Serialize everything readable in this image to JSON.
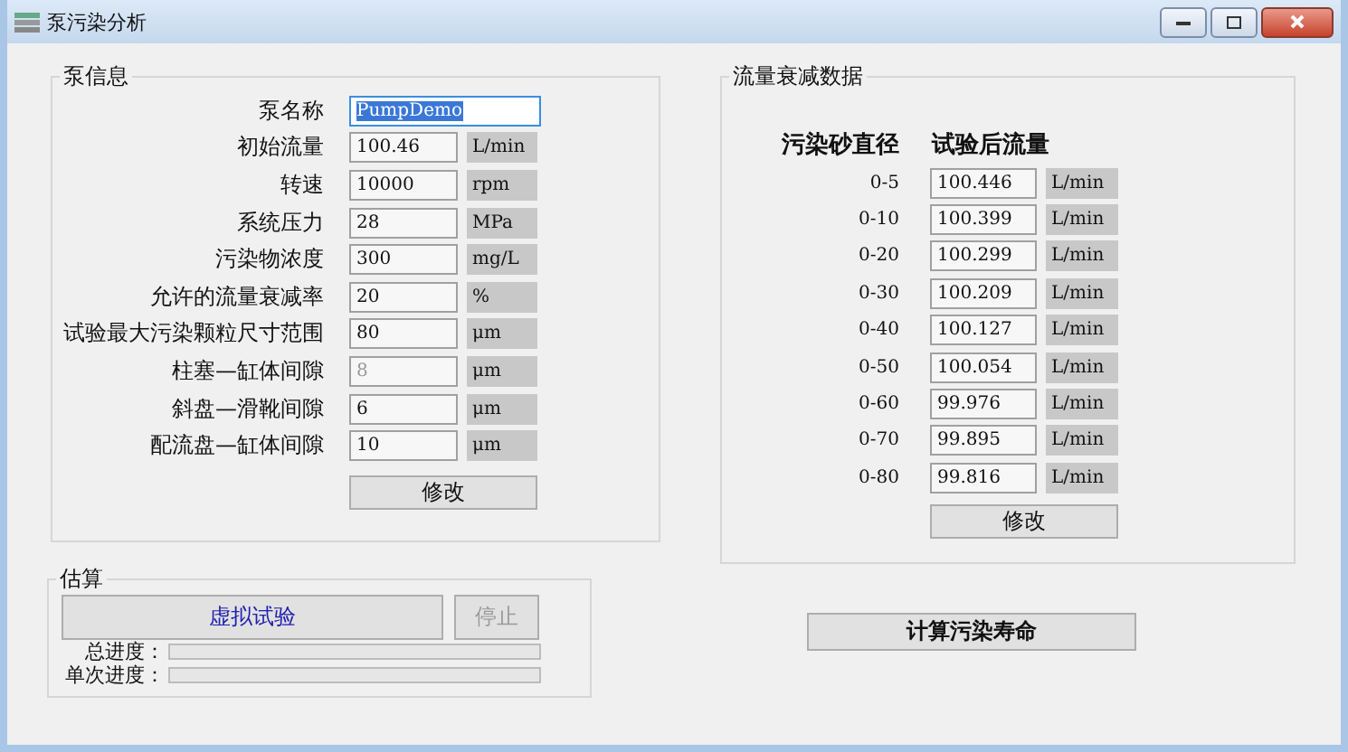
{
  "window": {
    "title": "泵污染分析"
  },
  "pump_info": {
    "title": "泵信息",
    "fields": [
      {
        "label": "泵名称",
        "value": "PumpDemo",
        "selected": true,
        "disabled": false
      },
      {
        "label": "初始流量",
        "value": "100.46",
        "unit": "L/min",
        "selected": false,
        "disabled": false
      },
      {
        "label": "转速",
        "value": "10000",
        "unit": "rpm",
        "selected": false,
        "disabled": false
      },
      {
        "label": "系统压力",
        "value": "28",
        "unit": "MPa",
        "selected": false,
        "disabled": false
      },
      {
        "label": "污染物浓度",
        "value": "300",
        "unit": "mg/L",
        "selected": false,
        "disabled": false
      },
      {
        "label": "允许的流量衰减率",
        "value": "20",
        "unit": "%",
        "selected": false,
        "disabled": false
      },
      {
        "label": "试验最大污染颗粒尺寸范围",
        "value": "80",
        "unit": "μm",
        "selected": false,
        "disabled": false
      },
      {
        "label": "柱塞—缸体间隙",
        "value": "8",
        "unit": "μm",
        "selected": false,
        "disabled": true
      },
      {
        "label": "斜盘—滑靴间隙",
        "value": "6",
        "unit": "μm",
        "selected": false,
        "disabled": false
      },
      {
        "label": "配流盘—缸体间隙",
        "value": "10",
        "unit": "μm",
        "selected": false,
        "disabled": false
      }
    ],
    "button": "修改"
  },
  "flow_decay": {
    "title": "流量衰减数据",
    "columns": [
      "污染砂直径",
      "试验后流量"
    ],
    "rows": [
      {
        "range": "0-5",
        "value": "100.446",
        "unit": "L/min"
      },
      {
        "range": "0-10",
        "value": "100.399",
        "unit": "L/min"
      },
      {
        "range": "0-20",
        "value": "100.299",
        "unit": "L/min"
      },
      {
        "range": "0-30",
        "value": "100.209",
        "unit": "L/min"
      },
      {
        "range": "0-40",
        "value": "100.127",
        "unit": "L/min"
      },
      {
        "range": "0-50",
        "value": "100.054",
        "unit": "L/min"
      },
      {
        "range": "0-60",
        "value": "99.976",
        "unit": "L/min"
      },
      {
        "range": "0-70",
        "value": "99.895",
        "unit": "L/min"
      },
      {
        "range": "0-80",
        "value": "99.816",
        "unit": "L/min"
      }
    ],
    "button": "修改"
  },
  "estimate": {
    "title": "估算",
    "run_button": {
      "label": "虚拟试验",
      "disabled": false
    },
    "stop_button": {
      "label": "停止",
      "disabled": true
    },
    "progress": [
      {
        "label": "总进度：",
        "level": 0
      },
      {
        "label": "单次进度：",
        "level": 0
      }
    ]
  },
  "compute_button": "计算污染寿命"
}
